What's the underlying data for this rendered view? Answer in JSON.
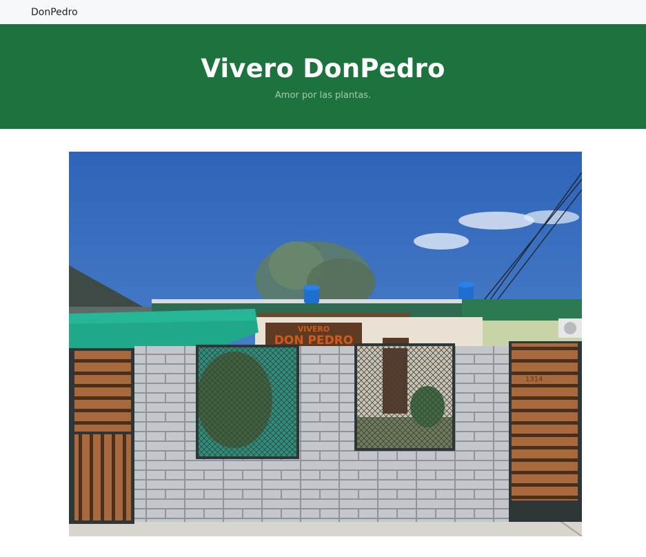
{
  "nav": {
    "brand": "DonPedro"
  },
  "hero": {
    "title": "Vivero DonPedro",
    "subtitle": "Amor por las plantas."
  },
  "storefront_photo": {
    "sign_line1": "VIVERO",
    "sign_line2": "DON PEDRO",
    "house_number": "1314"
  },
  "colors": {
    "nav_bg": "#f7f8fa",
    "hero_bg": "#1c733e",
    "hero_title": "#ffffff",
    "hero_subtitle": "#a9c7b2"
  }
}
